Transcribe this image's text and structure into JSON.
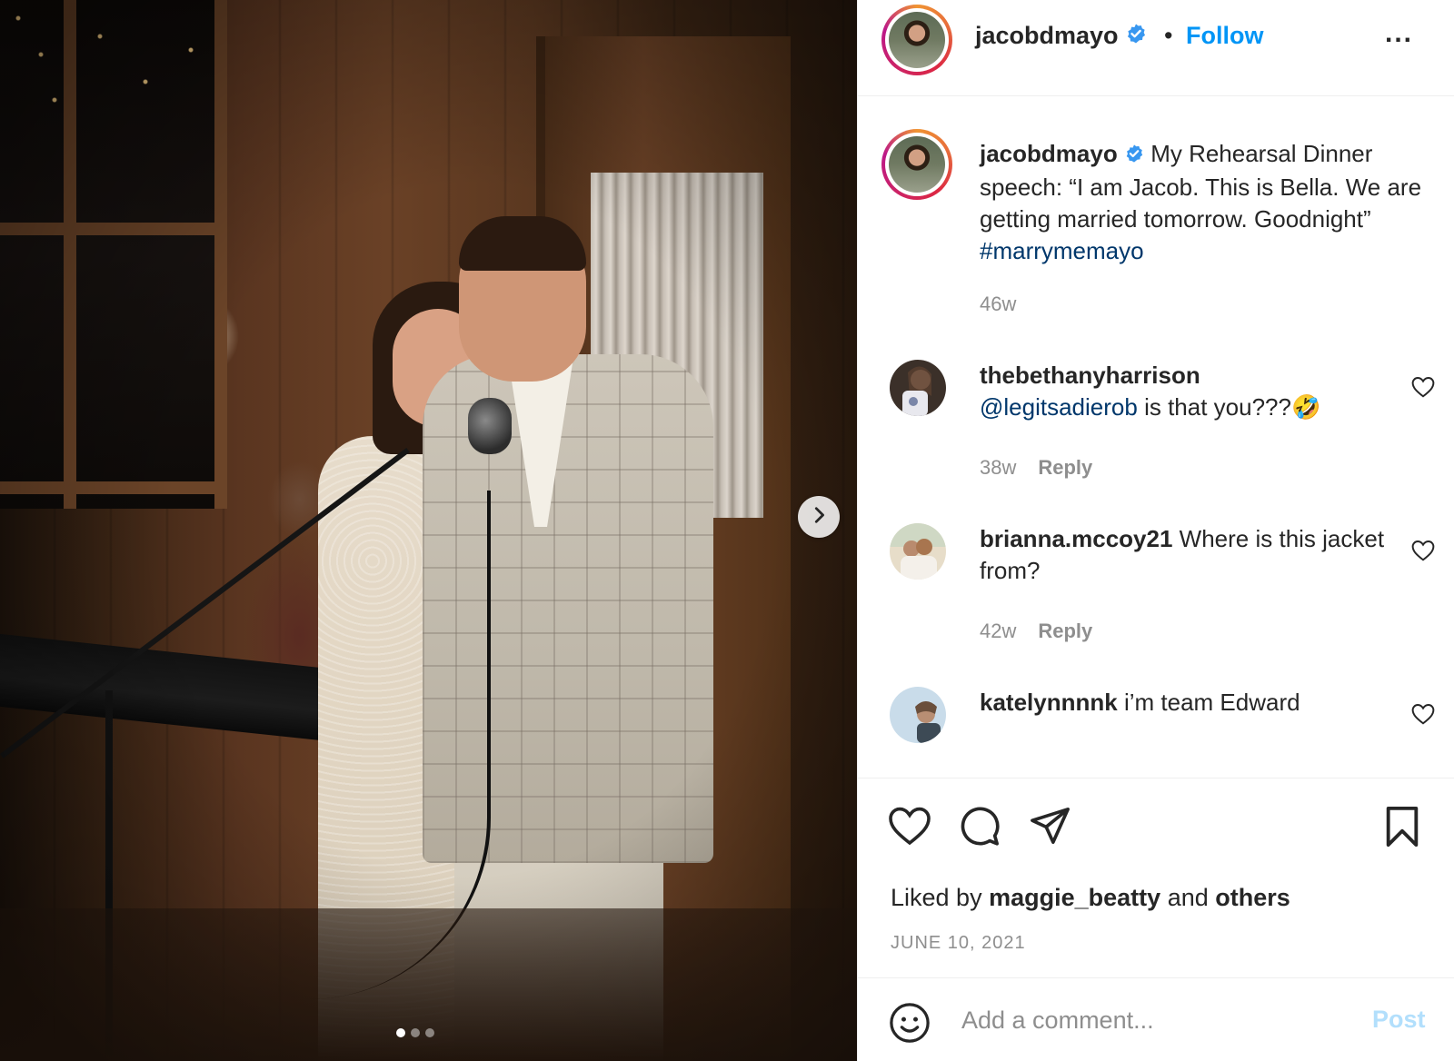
{
  "post": {
    "carousel_dots": 3,
    "active_dot": 0
  },
  "header": {
    "username": "jacobdmayo",
    "separator": "•",
    "follow_label": "Follow",
    "more_label": "..."
  },
  "caption": {
    "username": "jacobdmayo",
    "text": "My Rehearsal Dinner speech: “I am Jacob. This is Bella. We are getting married tomorrow. Goodnight”",
    "hashtag": "#marrymemayo",
    "age": "46w"
  },
  "comments": [
    {
      "username": "thebethanyharrison",
      "mention": "@legitsadierob",
      "text": "is that you???🤣",
      "age": "38w",
      "reply_label": "Reply"
    },
    {
      "username": "brianna.mccoy21",
      "text": "Where is this jacket from?",
      "age": "42w",
      "reply_label": "Reply"
    },
    {
      "username": "katelynnnnk",
      "text": "i’m team Edward"
    }
  ],
  "likes": {
    "prefix": "Liked by",
    "user": "maggie_beatty",
    "connector": "and",
    "others": "others"
  },
  "date": "JUNE 10, 2021",
  "add_comment": {
    "placeholder": "Add a comment...",
    "post_label": "Post"
  },
  "colors": {
    "link_blue": "#0095f6",
    "hashtag_blue": "#00376b",
    "muted": "#8e8e8e",
    "post_disabled": "#b2dffc",
    "verified": "#3897f0"
  },
  "icons": {
    "verified": "verified-badge-icon",
    "next": "chevron-right-icon",
    "like": "heart-icon",
    "comment": "comment-bubble-icon",
    "share": "paper-plane-icon",
    "save": "bookmark-icon",
    "emoji": "smiley-icon",
    "more": "more-horizontal-icon"
  }
}
